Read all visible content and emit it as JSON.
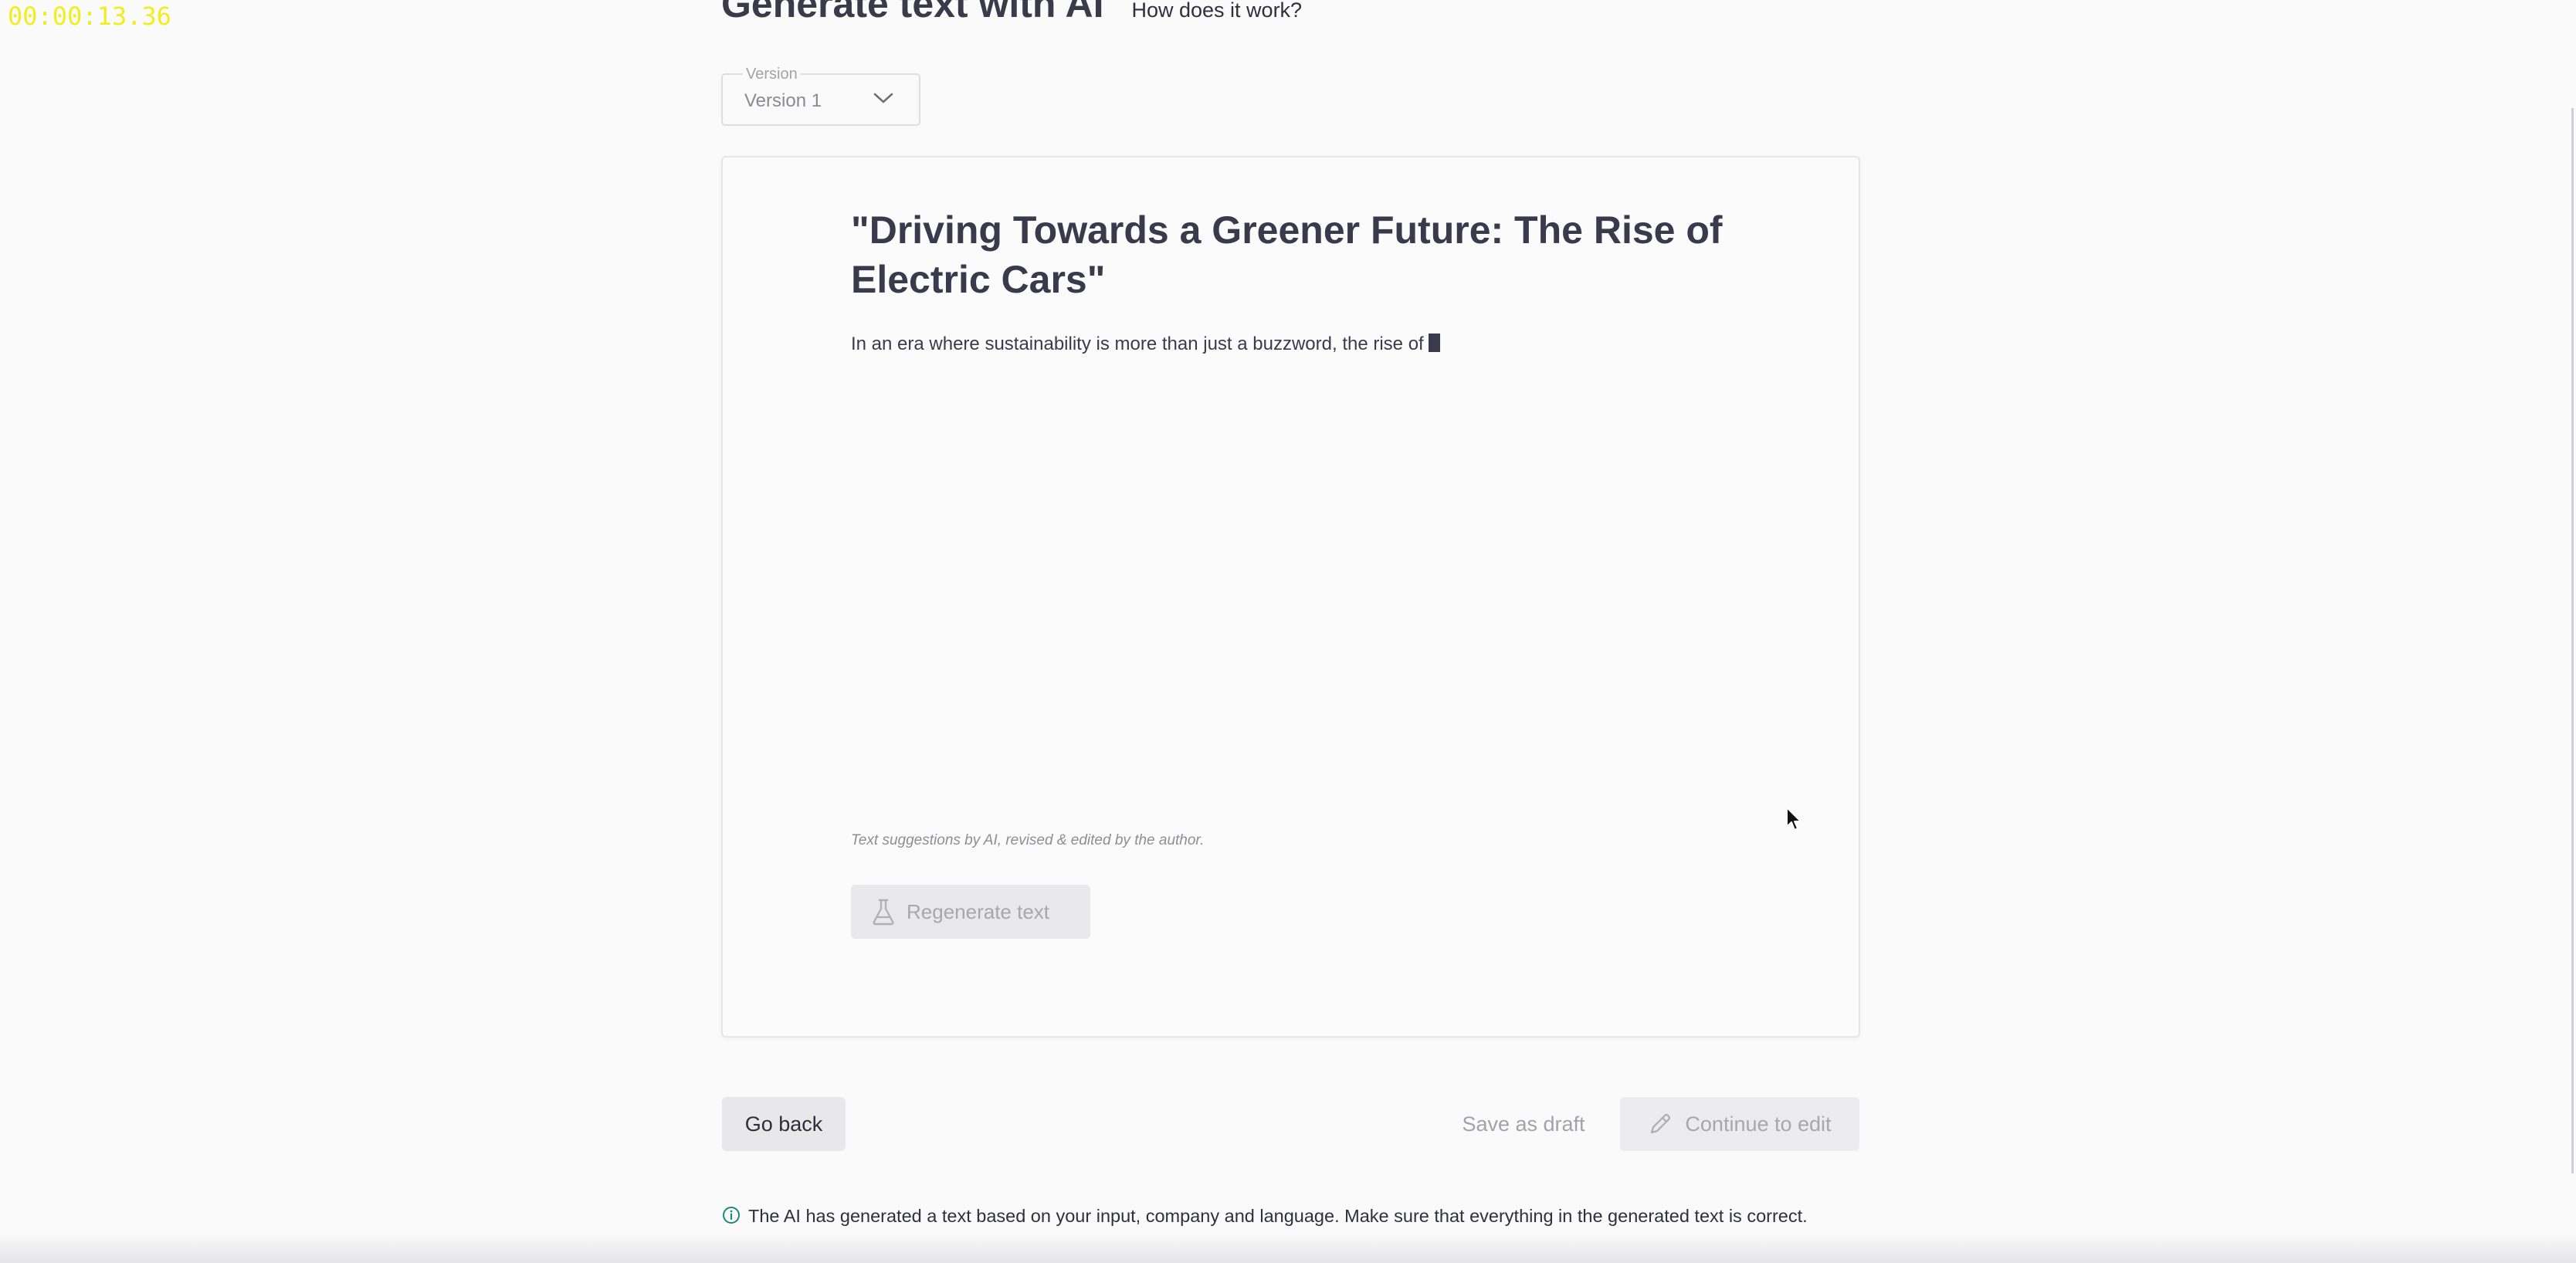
{
  "recording": {
    "timer": "00:00:13.36"
  },
  "header": {
    "title": "Generate text with AI",
    "help_link": "How does it work?"
  },
  "version_select": {
    "label": "Version",
    "value": "Version 1",
    "icon": "chevron-down-icon"
  },
  "editor": {
    "title": "\"Driving Towards a Greener Future: The Rise of Electric Cars\"",
    "body": "In an era where sustainability is more than just a buzzword, the rise of",
    "disclaimer": "Text suggestions by AI, revised & edited by the author.",
    "regenerate_label": "Regenerate text",
    "regenerate_icon": "flask-icon"
  },
  "footer": {
    "go_back_label": "Go back",
    "save_draft_label": "Save as draft",
    "continue_label": "Continue to edit",
    "continue_icon": "pencil-icon"
  },
  "info": {
    "icon": "info-icon",
    "text": "The AI has generated a text based on your input, company and language. Make sure that everything in the generated text is correct."
  },
  "colors": {
    "timer": "#f1ee1c",
    "text_primary": "#3b3a4c",
    "disabled_text": "#a7a7ad",
    "disabled_bg": "#e9e9ec",
    "info_icon": "#1a8a7a"
  }
}
